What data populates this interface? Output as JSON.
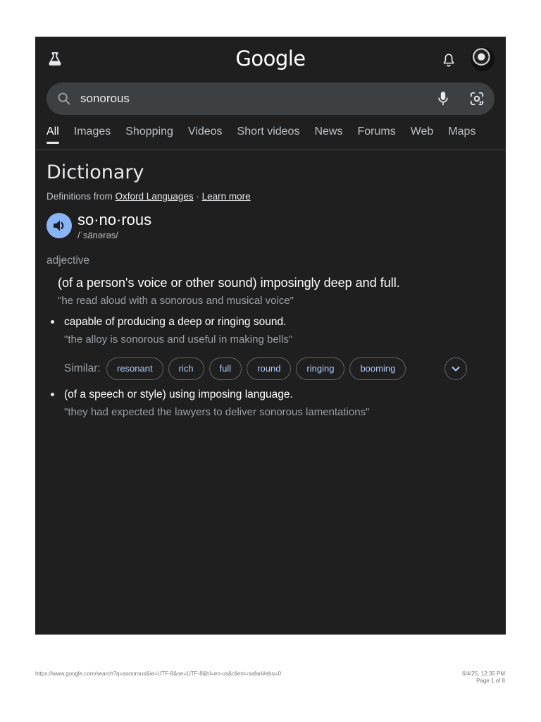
{
  "header": {
    "logo": "Google",
    "labs_icon": "flask-icon",
    "notifications_icon": "bell-icon",
    "avatar_icon": "avatar"
  },
  "search": {
    "query": "sonorous",
    "search_icon": "search-icon",
    "voice_icon": "mic-icon",
    "lens_icon": "lens-icon"
  },
  "tabs": [
    {
      "label": "All",
      "active": true
    },
    {
      "label": "Images"
    },
    {
      "label": "Shopping"
    },
    {
      "label": "Videos"
    },
    {
      "label": "Short videos"
    },
    {
      "label": "News"
    },
    {
      "label": "Forums"
    },
    {
      "label": "Web"
    },
    {
      "label": "Maps"
    }
  ],
  "dictionary": {
    "title": "Dictionary",
    "source_prefix": "Definitions from ",
    "source_link": "Oxford Languages",
    "source_sep": " · ",
    "learn_more": "Learn more",
    "word": "so·no·rous",
    "phonetic": "/ˈsänərəs/",
    "part_of_speech": "adjective",
    "definitions": [
      {
        "text": "(of a person's voice or other sound) imposingly deep and full.",
        "example": "\"he read aloud with a sonorous and musical voice\""
      },
      {
        "text": "capable of producing a deep or ringing sound.",
        "example": "\"the alloy is sonorous and useful in making bells\""
      },
      {
        "text": "(of a speech or style) using imposing language.",
        "example": "\"they had expected the lawyers to deliver sonorous lamentations\""
      }
    ],
    "similar_label": "Similar:",
    "similar": [
      "resonant",
      "rich",
      "full",
      "round",
      "ringing",
      "booming"
    ]
  },
  "colors": {
    "background": "#1f1f1f",
    "search_bar": "#3c4043",
    "accent_blue": "#8ab4f8",
    "chip_text": "#aecbfa"
  },
  "footer": {
    "url": "https://www.google.com/search?q=sonorous&ie=UTF-8&oe=UTF-8&hl=en-us&client=safari#ebo=0",
    "datetime": "6/4/25, 12:35 PM",
    "page": "Page 1 of 8"
  }
}
